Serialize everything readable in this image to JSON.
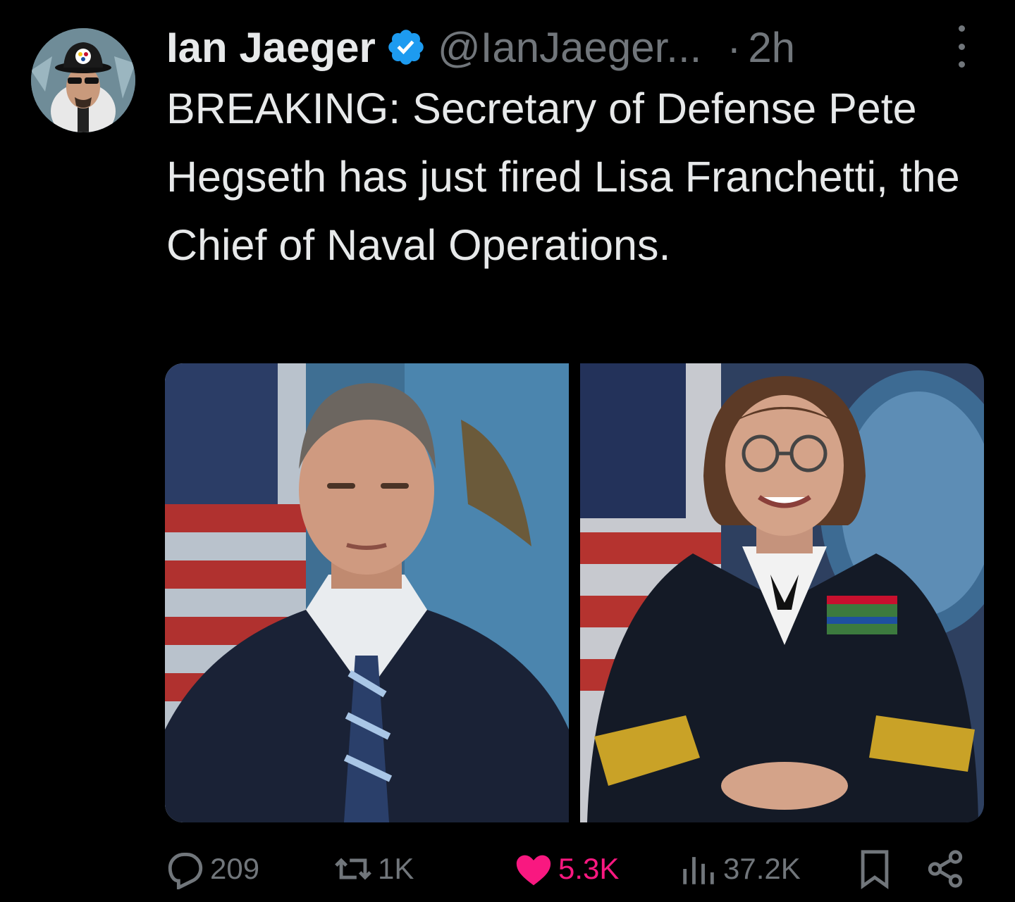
{
  "author": {
    "name": "Ian Jaeger",
    "handle": "@IanJaeger...",
    "time_separator": "·",
    "time": "2h",
    "avatar_icon": "profile-photo-man-with-cap",
    "verified_icon": "verified-badge-icon",
    "verified_color": "#1d9bf0"
  },
  "tweet": {
    "text": "BREAKING: Secretary of Defense Pete Hegseth has just fired Lisa Franchetti, the Chief of Naval Operations."
  },
  "media": {
    "left_photo_icon": "portrait-man-in-suit",
    "right_photo_icon": "portrait-woman-in-navy-uniform"
  },
  "actions": {
    "replies": "209",
    "reposts": "1K",
    "likes": "5.3K",
    "views": "37.2K",
    "like_color": "#f91880",
    "muted_color": "#71767b"
  }
}
